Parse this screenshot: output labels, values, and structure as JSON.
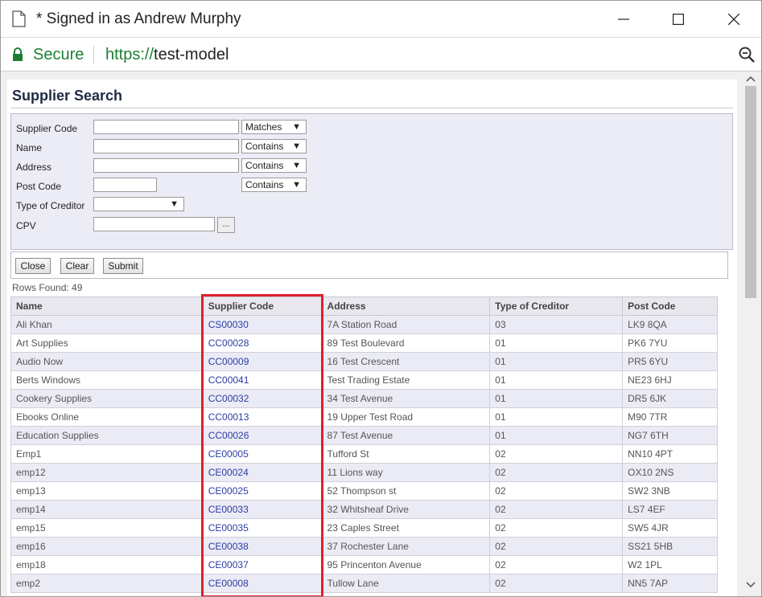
{
  "window": {
    "title": "* Signed in as Andrew Murphy"
  },
  "address_bar": {
    "secure_label": "Secure",
    "url_protocol": "https://",
    "url_host": "test-model"
  },
  "page": {
    "title": "Supplier Search",
    "fields": {
      "supplier_code": {
        "label": "Supplier Code",
        "value": "",
        "match": "Matches"
      },
      "name": {
        "label": "Name",
        "value": "",
        "match": "Contains"
      },
      "address": {
        "label": "Address",
        "value": "",
        "match": "Contains"
      },
      "post_code": {
        "label": "Post Code",
        "value": "",
        "match": "Contains"
      },
      "type_of_creditor": {
        "label": "Type of Creditor",
        "value": ""
      },
      "cpv": {
        "label": "CPV",
        "value": "",
        "browse_label": "..."
      }
    },
    "buttons": {
      "close": "Close",
      "clear": "Clear",
      "submit": "Submit"
    },
    "rows_found": "Rows Found: 49",
    "table": {
      "columns": [
        "Name",
        "Supplier Code",
        "Address",
        "Type of Creditor",
        "Post Code"
      ],
      "rows": [
        [
          "Ali Khan",
          "CS00030",
          "7A Station Road",
          "03",
          "LK9 8QA"
        ],
        [
          "Art Supplies",
          "CC00028",
          "89 Test Boulevard",
          "01",
          "PK6 7YU"
        ],
        [
          "Audio Now",
          "CC00009",
          "16 Test Crescent",
          "01",
          "PR5 6YU"
        ],
        [
          "Berts Windows",
          "CC00041",
          "Test Trading Estate",
          "01",
          "NE23 6HJ"
        ],
        [
          "Cookery Supplies",
          "CC00032",
          "34 Test Avenue",
          "01",
          "DR5 6JK"
        ],
        [
          "Ebooks Online",
          "CC00013",
          "19 Upper Test Road",
          "01",
          "M90 7TR"
        ],
        [
          "Education Supplies",
          "CC00026",
          "87 Test Avenue",
          "01",
          "NG7 6TH"
        ],
        [
          "Emp1",
          "CE00005",
          "Tufford St",
          "02",
          "NN10 4PT"
        ],
        [
          "emp12",
          "CE00024",
          "11 Lions way",
          "02",
          "OX10 2NS"
        ],
        [
          "emp13",
          "CE00025",
          "52 Thompson st",
          "02",
          "SW2 3NB"
        ],
        [
          "emp14",
          "CE00033",
          "32 Whitsheaf Drive",
          "02",
          "LS7 4EF"
        ],
        [
          "emp15",
          "CE00035",
          "23 Caples Street",
          "02",
          "SW5 4JR"
        ],
        [
          "emp16",
          "CE00038",
          "37 Rochester Lane",
          "02",
          "SS21 5HB"
        ],
        [
          "emp18",
          "CE00037",
          "95 Princenton Avenue",
          "02",
          "W2 1PL"
        ],
        [
          "emp2",
          "CE00008",
          "Tullow Lane",
          "02",
          "NN5 7AP"
        ]
      ]
    }
  },
  "colors": {
    "secure_green": "#1e7e34",
    "link_blue": "#2c3ca4",
    "highlight_red": "#e0202a",
    "panel_bg": "#ececf6"
  },
  "icons": [
    "document-icon",
    "minimize-icon",
    "maximize-icon",
    "close-icon",
    "lock-icon",
    "zoom-icon",
    "scroll-up-icon",
    "scroll-down-icon"
  ]
}
